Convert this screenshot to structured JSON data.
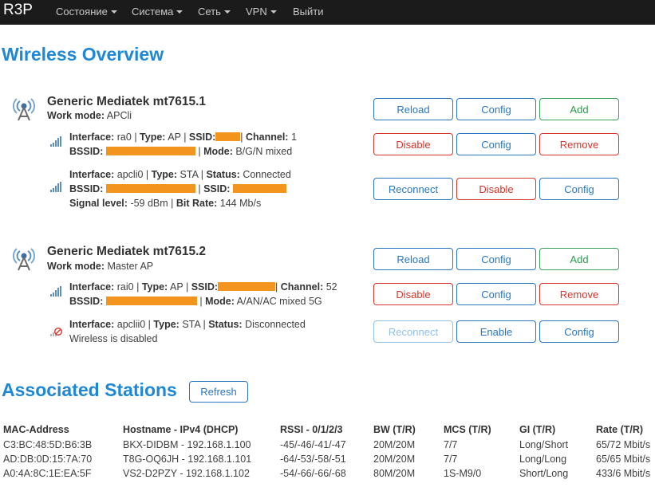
{
  "nav": {
    "brand": "R3P",
    "items": [
      "Состояние",
      "Система",
      "Сеть",
      "VPN",
      "Выйти"
    ]
  },
  "overview_title": "Wireless Overview",
  "devices": [
    {
      "name": "Generic Mediatek mt7615.1",
      "work_mode_label": "Work mode:",
      "work_mode": "APCli",
      "buttons": [
        "Reload",
        "Config",
        "Add"
      ],
      "networks": [
        {
          "line1": {
            "interface_label": "Interface:",
            "interface": "ra0",
            "type_label": "Type:",
            "type": "AP",
            "ssid_label": "SSID:",
            "channel_label": "Channel:",
            "channel": "1"
          },
          "line2": {
            "bssid_label": "BSSID:",
            "mode_label": "Mode:",
            "mode": "B/G/N mixed"
          },
          "buttons": [
            "Disable",
            "Config",
            "Remove"
          ]
        },
        {
          "line1": {
            "interface_label": "Interface:",
            "interface": "apcli0",
            "type_label": "Type:",
            "type": "STA",
            "status_label": "Status:",
            "status": "Connected"
          },
          "line2": {
            "bssid_label": "BSSID:",
            "ssid_label": "SSID:"
          },
          "line3": {
            "signal_label": "Signal level:",
            "signal": "-59 dBm",
            "bitrate_label": "Bit Rate:",
            "bitrate": "144 Mb/s"
          },
          "buttons": [
            "Reconnect",
            "Disable",
            "Config"
          ]
        }
      ]
    },
    {
      "name": "Generic Mediatek mt7615.2",
      "work_mode_label": "Work mode:",
      "work_mode": "Master AP",
      "buttons": [
        "Reload",
        "Config",
        "Add"
      ],
      "networks": [
        {
          "line1": {
            "interface_label": "Interface:",
            "interface": "rai0",
            "type_label": "Type:",
            "type": "AP",
            "ssid_label": "SSID:",
            "channel_label": "Channel:",
            "channel": "52"
          },
          "line2": {
            "bssid_label": "BSSID:",
            "mode_label": "Mode:",
            "mode": "A/AN/AC mixed 5G"
          },
          "buttons": [
            "Disable",
            "Config",
            "Remove"
          ]
        },
        {
          "line1": {
            "interface_label": "Interface:",
            "interface": "apclii0",
            "type_label": "Type:",
            "type": "STA",
            "status_label": "Status:",
            "status": "Disconnected"
          },
          "line2": {
            "text": "Wireless is disabled"
          },
          "buttons": [
            "Reconnect",
            "Enable",
            "Config"
          ]
        }
      ]
    }
  ],
  "stations": {
    "title": "Associated Stations",
    "refresh_label": "Refresh",
    "headers": [
      "MAC-Address",
      "Hostname - IPv4 (DHCP)",
      "RSSI - 0/1/2/3",
      "BW (T/R)",
      "MCS (T/R)",
      "GI (T/R)",
      "Rate (T/R)"
    ],
    "rows": [
      [
        "C3:BC:48:5D:B6:3B",
        "BKX-DIDBM - 192.168.1.100",
        "-45/-46/-41/-47",
        "20M/20M",
        "7/7",
        "Long/Short",
        "65/72 Mbit/s"
      ],
      [
        "AD:DB:0D:15:7A:70",
        "T8G-OQ6JH - 192.168.1.101",
        "-64/-53/-58/-51",
        "20M/20M",
        "7/7",
        "Long/Long",
        "65/65 Mbit/s"
      ],
      [
        "A0:4A:8C:1E:EA:5F",
        "VS2-D2PZY - 192.168.1.102",
        "-54/-66/-66/-68",
        "80M/20M",
        "1S-M9/0",
        "Short/Long",
        "433/6 Mbit/s"
      ]
    ]
  },
  "colors": {
    "accent": "#1e88d6",
    "navbar": "#1b1b1b",
    "redaction": "#f3941e",
    "button_blue": "#2a77c0",
    "button_green": "#3aa55a",
    "button_red": "#d9342b"
  },
  "icons": {
    "radio": "wifi-radio-icon",
    "signal": "signal-bars-icon",
    "disabled": "signal-disabled-icon"
  }
}
